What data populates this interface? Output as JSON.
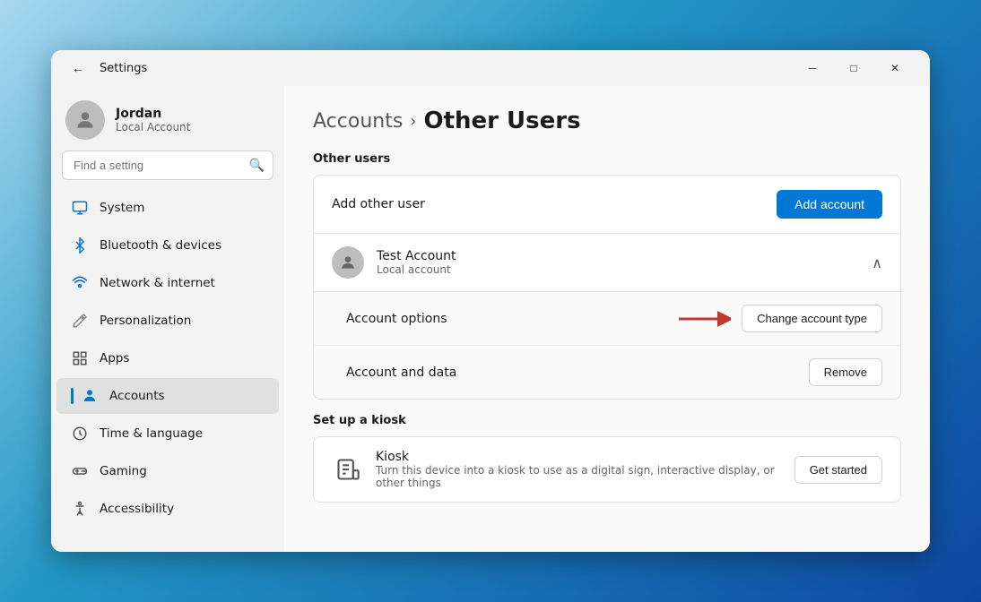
{
  "window": {
    "title": "Settings",
    "min_label": "─",
    "max_label": "□",
    "close_label": "✕"
  },
  "user": {
    "name": "Jordan",
    "account_type": "Local Account"
  },
  "search": {
    "placeholder": "Find a setting"
  },
  "nav": {
    "items": [
      {
        "id": "system",
        "label": "System",
        "icon": "🖥"
      },
      {
        "id": "bluetooth",
        "label": "Bluetooth & devices",
        "icon": "🔷"
      },
      {
        "id": "network",
        "label": "Network & internet",
        "icon": "🌐"
      },
      {
        "id": "personalization",
        "label": "Personalization",
        "icon": "✏️"
      },
      {
        "id": "apps",
        "label": "Apps",
        "icon": "🗂"
      },
      {
        "id": "accounts",
        "label": "Accounts",
        "icon": "👤",
        "active": true
      },
      {
        "id": "time",
        "label": "Time & language",
        "icon": "🕐"
      },
      {
        "id": "gaming",
        "label": "Gaming",
        "icon": "🎮"
      },
      {
        "id": "accessibility",
        "label": "Accessibility",
        "icon": "♿"
      }
    ]
  },
  "main": {
    "breadcrumb_parent": "Accounts",
    "breadcrumb_separator": "›",
    "breadcrumb_current": "Other Users",
    "other_users_section": "Other users",
    "add_other_user_label": "Add other user",
    "add_account_btn": "Add account",
    "test_account": {
      "name": "Test Account",
      "type": "Local account"
    },
    "account_options_label": "Account options",
    "change_account_type_btn": "Change account type",
    "account_and_data_label": "Account and data",
    "remove_btn": "Remove",
    "kiosk_section": "Set up a kiosk",
    "kiosk_name": "Kiosk",
    "kiosk_desc": "Turn this device into a kiosk to use as a digital sign, interactive display, or other things",
    "get_started_btn": "Get started"
  }
}
